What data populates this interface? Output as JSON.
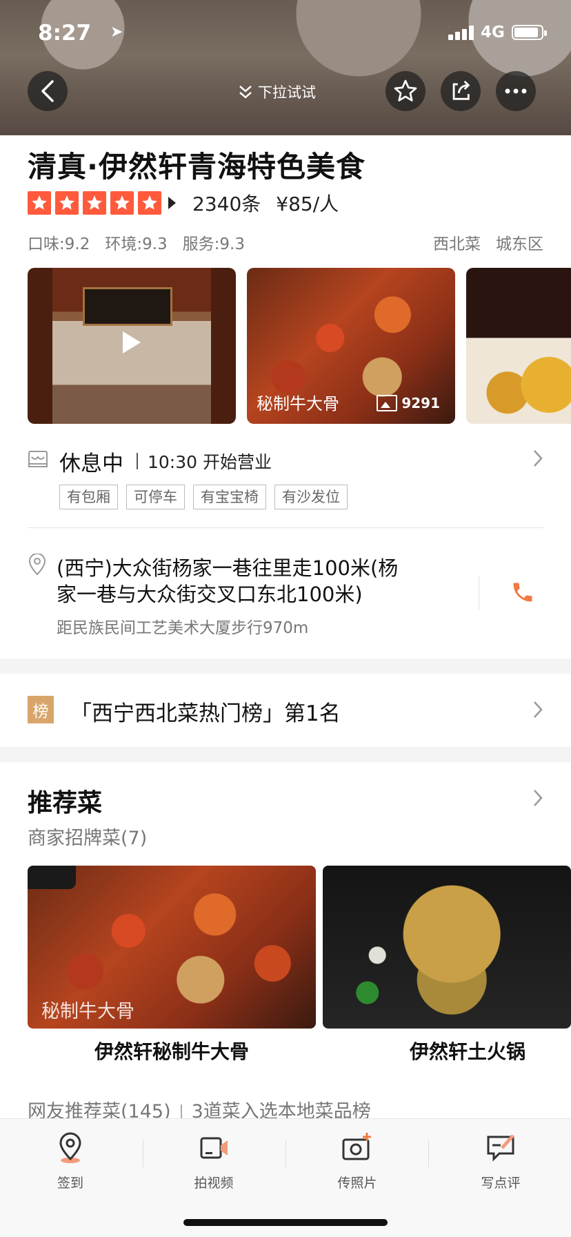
{
  "status_bar": {
    "time": "8:27",
    "network": "4G"
  },
  "header": {
    "pull_hint": "下拉试试"
  },
  "shop": {
    "name": "清真·伊然轩青海特色美食",
    "review_count": "2340条",
    "price": "¥85/人",
    "rating_stars": 5,
    "scores": [
      "口味:9.2",
      "环境:9.3",
      "服务:9.3"
    ],
    "category": "西北菜",
    "district": "城东区"
  },
  "photos": {
    "caption": "秘制牛大骨",
    "count": "9291"
  },
  "hours": {
    "status": "休息中",
    "open_time": "10:30 开始营业",
    "facilities": [
      "有包厢",
      "可停车",
      "有宝宝椅",
      "有沙发位"
    ]
  },
  "address": {
    "line1": "(西宁)大众街杨家一巷往里走100米(杨",
    "line2": "家一巷与大众街交叉口东北100米)",
    "distance": "距民族民间工艺美术大厦步行970m"
  },
  "ranking": {
    "badge": "榜",
    "text": "「西宁西北菜热门榜」第1名"
  },
  "recommended": {
    "title": "推荐菜",
    "subtitle": "商家招牌菜(7)",
    "dishes": [
      {
        "name": "伊然轩秘制牛大骨",
        "caption": "秘制牛大骨"
      },
      {
        "name": "伊然轩土火锅"
      }
    ],
    "netizen_count": "网友推荐菜(145)",
    "netizen_note": "3道菜入选本地菜品榜"
  },
  "tabbar": [
    {
      "label": "签到",
      "icon": "location-pin-icon"
    },
    {
      "label": "拍视频",
      "icon": "video-camera-icon"
    },
    {
      "label": "传照片",
      "icon": "add-photo-icon"
    },
    {
      "label": "写点评",
      "icon": "write-review-icon"
    }
  ],
  "colors": {
    "accent": "#ff5a3c",
    "phone": "#f07a43",
    "badge": "#d8a56a"
  }
}
